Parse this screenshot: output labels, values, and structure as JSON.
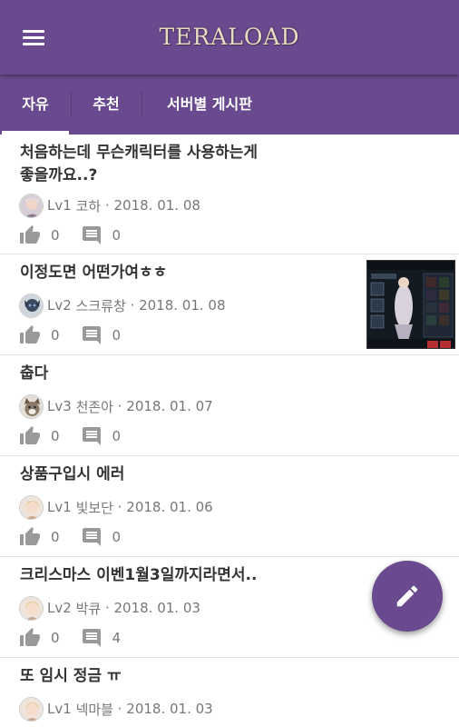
{
  "header": {
    "title": "TERALOAD"
  },
  "tabs": [
    {
      "label": "자유",
      "active": true
    },
    {
      "label": "추천",
      "active": false
    },
    {
      "label": "서버별 게시판",
      "active": false
    }
  ],
  "posts": [
    {
      "title_line1": "처음하는데 무슨캐릭터를 사용하는게",
      "title_line2": "좋을까요..?",
      "level": "Lv1",
      "author": "코하",
      "date": "2018. 01. 08",
      "likes": "0",
      "comments": "0"
    },
    {
      "title_line1": "이정도면 어떤가여ㅎㅎ",
      "level": "Lv2",
      "author": "스크류창",
      "date": "2018. 01. 08",
      "likes": "0",
      "comments": "0",
      "has_thumbnail": true
    },
    {
      "title_line1": "춥다",
      "level": "Lv3",
      "author": "천존아",
      "date": "2018. 01. 07",
      "likes": "0",
      "comments": "0"
    },
    {
      "title_line1": "상품구입시 에러",
      "level": "Lv1",
      "author": "빛보단",
      "date": "2018. 01. 06",
      "likes": "0",
      "comments": "0"
    },
    {
      "title_line1": "크리스마스 이벤1월3일까지라면서..",
      "level": "Lv2",
      "author": "박큐",
      "date": "2018. 01. 03",
      "likes": "0",
      "comments": "4"
    },
    {
      "title_line1": "또 임시 정금 ㅠ",
      "level": "Lv1",
      "author": "넥마블",
      "date": "2018. 01. 03"
    }
  ],
  "icons": {
    "menu": "menu-icon",
    "like": "thumb-up-icon",
    "comment": "comment-icon",
    "write": "pencil-icon"
  },
  "colors": {
    "primary": "#6a4a8e",
    "text": "#333333",
    "meta": "#777777"
  }
}
